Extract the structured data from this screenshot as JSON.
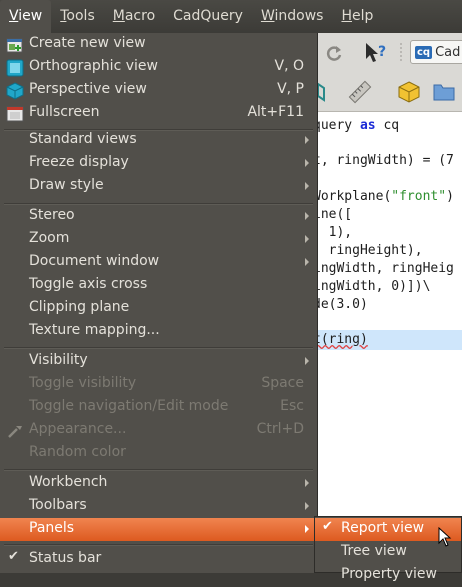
{
  "menubar": {
    "items": [
      {
        "label": "View",
        "mnemonic": "V",
        "rest": "iew",
        "active": true
      },
      {
        "label": "Tools",
        "mnemonic": "T",
        "rest": "ools"
      },
      {
        "label": "Macro",
        "mnemonic": "M",
        "rest": "acro"
      },
      {
        "label": "CadQuery",
        "mnemonic": "",
        "rest": "CadQuery"
      },
      {
        "label": "Windows",
        "mnemonic": "W",
        "rest": "indows"
      },
      {
        "label": "Help",
        "mnemonic": "H",
        "rest": "elp"
      }
    ]
  },
  "toolbar": {
    "workbench_label": "Cad"
  },
  "editor": {
    "lines": [
      {
        "a": "query ",
        "kw": "as",
        "b": " cq"
      },
      {
        "text": "t, ringWidth) = (7"
      },
      {
        "a": "Workplane(",
        "str": "\"front\"",
        "b": ")"
      },
      {
        "text": "ine(["
      },
      {
        "text": ", 1),"
      },
      {
        "text": ", ringHeight),"
      },
      {
        "text": "ingWidth, ringHeig"
      },
      {
        "text": "ingWidth, 0)])\\"
      },
      {
        "text": "de(3.0)"
      },
      {
        "text": "t(ring)"
      }
    ]
  },
  "view_menu": {
    "create_new_view": "Create new view",
    "orthographic": {
      "label": "Orthographic view",
      "shortcut": "V, O"
    },
    "perspective": {
      "label": "Perspective view",
      "shortcut": "V, P"
    },
    "fullscreen": {
      "label": "Fullscreen",
      "shortcut": "Alt+F11"
    },
    "standard_views": "Standard views",
    "freeze_display": "Freeze display",
    "draw_style": "Draw style",
    "stereo": "Stereo",
    "zoom": "Zoom",
    "document_window": "Document window",
    "toggle_axis_cross": "Toggle axis cross",
    "clipping_plane": "Clipping plane",
    "texture_mapping": "Texture mapping...",
    "visibility": "Visibility",
    "toggle_visibility": {
      "label": "Toggle visibility",
      "shortcut": "Space"
    },
    "toggle_navigation": {
      "label": "Toggle navigation/Edit mode",
      "shortcut": "Esc"
    },
    "appearance": {
      "label": "Appearance...",
      "shortcut": "Ctrl+D"
    },
    "random_color": "Random color",
    "workbench": "Workbench",
    "toolbars": "Toolbars",
    "panels": "Panels",
    "status_bar": "Status bar"
  },
  "panels_submenu": {
    "items": [
      {
        "label": "Report view",
        "checked": true
      },
      {
        "label": "Tree view",
        "checked": false
      },
      {
        "label": "Property view",
        "checked": false
      }
    ]
  },
  "colors": {
    "menu_bg": "#514f4a",
    "highlight": "#e8703a",
    "text": "#e4e1da",
    "disabled": "#7d7a72"
  }
}
